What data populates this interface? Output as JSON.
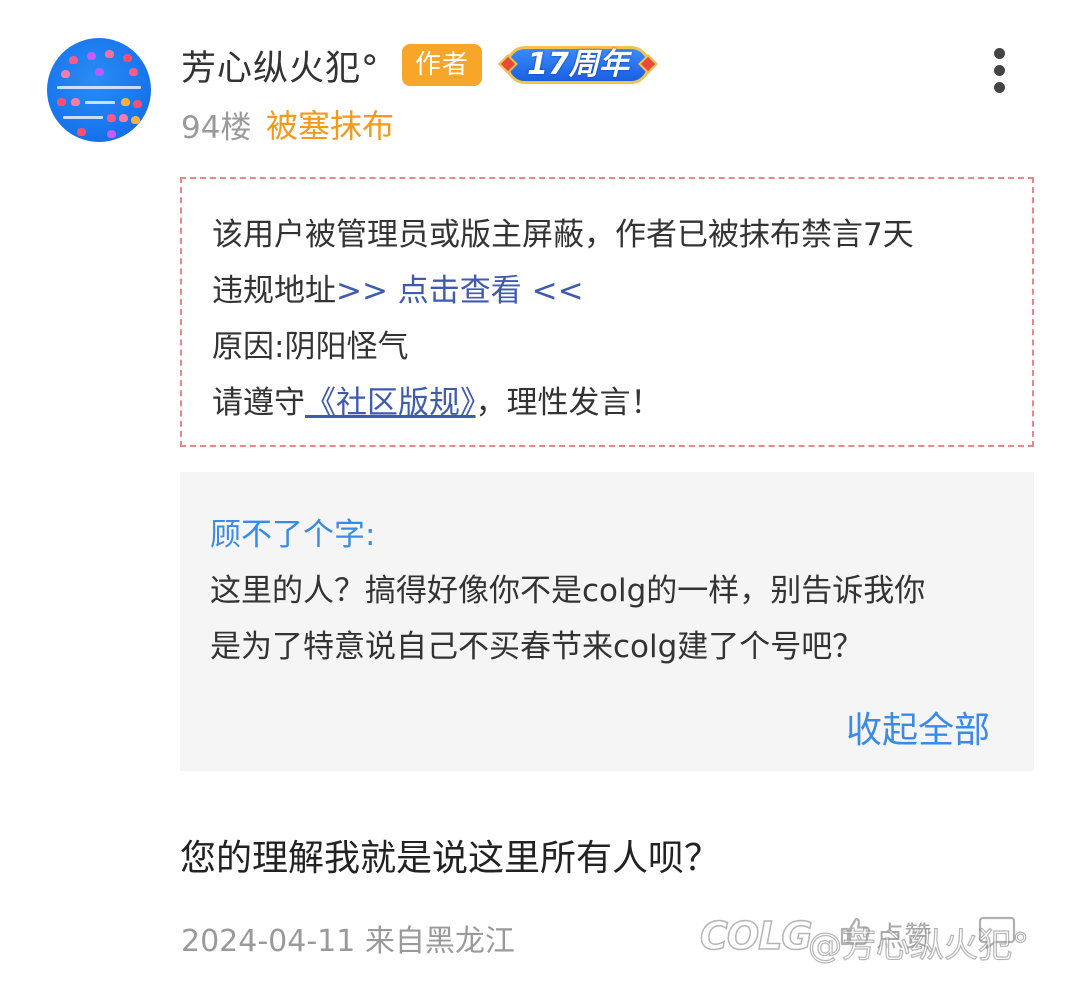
{
  "post": {
    "author": {
      "name": "芳心纵火犯°",
      "author_badge": "作者",
      "anniversary_badge": "17周年"
    },
    "floor": "94楼",
    "moderation_tag": "被塞抹布",
    "ban_notice": {
      "line1": "该用户被管理员或版主屏蔽，作者已被抹布禁言7天",
      "line2_prefix": "违规地址",
      "line2_link": ">> 点击查看 <<",
      "line3": "原因:阴阳怪气",
      "line4_prefix": "请遵守",
      "line4_link": "《社区版规》",
      "line4_suffix": "，理性发言！"
    },
    "quote": {
      "author": "顾不了个字:",
      "line1": "这里的人？搞得好像你不是colg的一样，别告诉我你",
      "line2": "是为了特意说自己不买春节来colg建了个号吧？",
      "collapse_label": "收起全部"
    },
    "content": "您的理解我就是说这里所有人呗？",
    "meta": "2024-04-11 来自黑龙江",
    "like_label": "点赞"
  },
  "watermark": {
    "logo": "COLG",
    "user": "@芳心纵火犯°"
  },
  "colors": {
    "author_badge": "#f8a62a",
    "moderation_tag": "#f39a1c",
    "link_blue": "#3f5bb0",
    "quote_blue": "#3a8be8",
    "ban_border": "#e68888",
    "quote_bg": "#f5f5f5"
  },
  "icons": {
    "more": "more-vertical-icon",
    "like": "thumbs-up-icon",
    "comment": "comment-icon"
  }
}
